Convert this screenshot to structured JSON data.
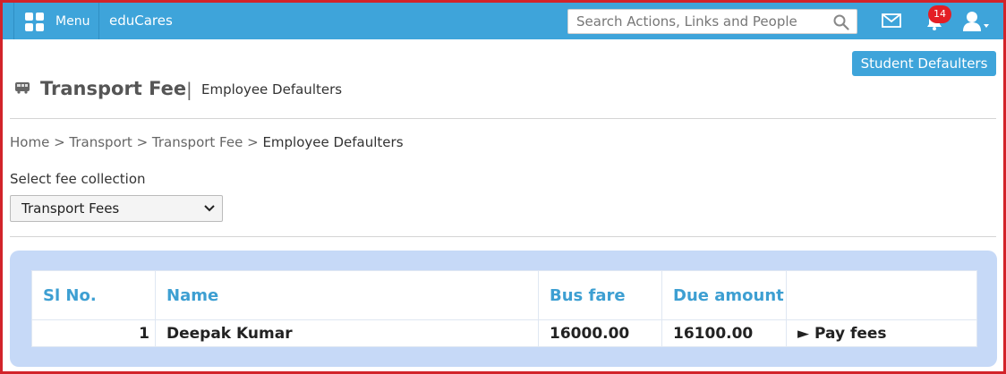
{
  "header": {
    "menu_label": "Menu",
    "brand": "eduCares",
    "search_placeholder": "Search Actions, Links and People",
    "notification_count": "14"
  },
  "page": {
    "student_defaulters_button": "Student Defaulters",
    "title": "Transport Fee",
    "separator": "|",
    "subtitle": "Employee Defaulters"
  },
  "breadcrumb": {
    "items": [
      "Home",
      "Transport",
      "Transport Fee"
    ],
    "separator": " > ",
    "current": "Employee Defaulters"
  },
  "fee_select": {
    "label": "Select fee collection",
    "selected": "Transport Fees"
  },
  "table": {
    "headers": [
      "Sl No.",
      "Name",
      "Bus fare",
      "Due amount",
      ""
    ],
    "rows": [
      {
        "sl_no": "1",
        "name": "Deepak Kumar",
        "bus_fare": "16000.00",
        "due_amount": "16100.00",
        "action": "► Pay fees"
      }
    ]
  },
  "colors": {
    "topbar": "#3ea4da",
    "badge": "#e41e25",
    "panel": "#c6d9f7",
    "header_text": "#3d9fd2",
    "frame": "#d2232a"
  }
}
